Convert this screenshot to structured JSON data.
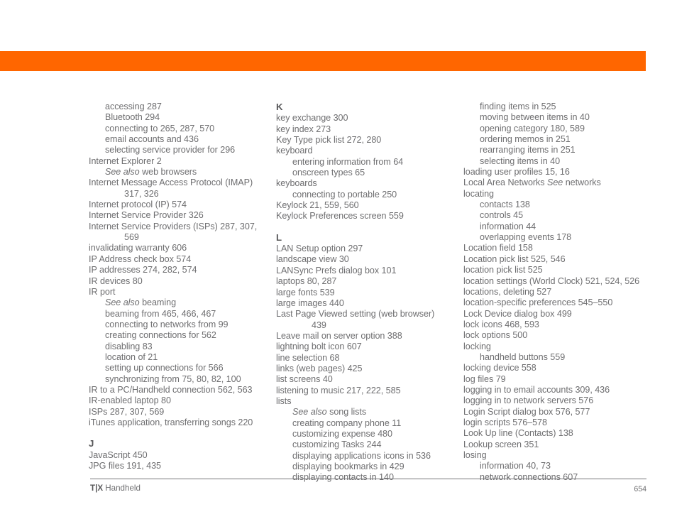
{
  "document": {
    "footer": {
      "brand": "T|X",
      "product": " Handheld",
      "page_number": "654"
    },
    "accent_color": "#ff6600",
    "text_color": "#6e6e70",
    "heading_color": "#58585a"
  },
  "columns": [
    {
      "name": "column-1",
      "blocks": [
        {
          "type": "entries",
          "items": [
            {
              "level": 1,
              "text": "accessing 287"
            },
            {
              "level": 1,
              "text": "Bluetooth 294"
            },
            {
              "level": 1,
              "text": "connecting to 265, 287, 570"
            },
            {
              "level": 1,
              "text": "email accounts and 436"
            },
            {
              "level": 1,
              "text": "selecting service provider for 296"
            },
            {
              "level": 0,
              "text": "Internet Explorer 2"
            },
            {
              "level": 1,
              "see_also": "See also",
              "text": " web browsers"
            },
            {
              "level": 0,
              "text": "Internet Message Access Protocol (IMAP)"
            },
            {
              "level": 0,
              "runover": true,
              "text": "317, 326"
            },
            {
              "level": 0,
              "text": "Internet protocol (IP) 574"
            },
            {
              "level": 0,
              "text": "Internet Service Provider 326"
            },
            {
              "level": 0,
              "text": "Internet Service Providers (ISPs) 287, 307,"
            },
            {
              "level": 0,
              "runover": true,
              "text": "569"
            },
            {
              "level": 0,
              "text": "invalidating warranty 606"
            },
            {
              "level": 0,
              "text": "IP Address check box 574"
            },
            {
              "level": 0,
              "text": "IP addresses 274, 282, 574"
            },
            {
              "level": 0,
              "text": "IR devices 80"
            },
            {
              "level": 0,
              "text": "IR port"
            },
            {
              "level": 1,
              "see_also": "See also",
              "text": " beaming"
            },
            {
              "level": 1,
              "text": "beaming from 465, 466, 467"
            },
            {
              "level": 1,
              "text": "connecting to networks from 99"
            },
            {
              "level": 1,
              "text": "creating connections for 562"
            },
            {
              "level": 1,
              "text": "disabling 83"
            },
            {
              "level": 1,
              "text": "location of 21"
            },
            {
              "level": 1,
              "text": "setting up connections for 566"
            },
            {
              "level": 1,
              "text": "synchronizing from 75, 80, 82, 100"
            },
            {
              "level": 0,
              "text": "IR to a PC/Handheld connection 562, 563"
            },
            {
              "level": 0,
              "text": "IR-enabled laptop 80"
            },
            {
              "level": 0,
              "text": "ISPs 287, 307, 569"
            },
            {
              "level": 0,
              "text": "iTunes application, transferring songs 220"
            }
          ]
        },
        {
          "type": "section",
          "letter": "J",
          "items": [
            {
              "level": 0,
              "text": "JavaScript 450"
            },
            {
              "level": 0,
              "text": "JPG files 191, 435"
            }
          ]
        }
      ]
    },
    {
      "name": "column-2",
      "blocks": [
        {
          "type": "section",
          "letter": "K",
          "first": true,
          "items": [
            {
              "level": 0,
              "text": "key exchange 300"
            },
            {
              "level": 0,
              "text": "key index 273"
            },
            {
              "level": 0,
              "text": "Key Type pick list 272, 280"
            },
            {
              "level": 0,
              "text": "keyboard"
            },
            {
              "level": 1,
              "text": "entering information from 64"
            },
            {
              "level": 1,
              "text": "onscreen types 65"
            },
            {
              "level": 0,
              "text": "keyboards"
            },
            {
              "level": 1,
              "text": "connecting to portable 250"
            },
            {
              "level": 0,
              "text": "Keylock 21, 559, 560"
            },
            {
              "level": 0,
              "text": "Keylock Preferences screen 559"
            }
          ]
        },
        {
          "type": "section",
          "letter": "L",
          "items": [
            {
              "level": 0,
              "text": "LAN Setup option 297"
            },
            {
              "level": 0,
              "text": "landscape view 30"
            },
            {
              "level": 0,
              "text": "LANSync Prefs dialog box 101"
            },
            {
              "level": 0,
              "text": "laptops 80, 287"
            },
            {
              "level": 0,
              "text": "large fonts 539"
            },
            {
              "level": 0,
              "text": "large images 440"
            },
            {
              "level": 0,
              "text": "Last Page Viewed setting (web browser)"
            },
            {
              "level": 0,
              "runover": true,
              "text": "439"
            },
            {
              "level": 0,
              "text": "Leave mail on server option 388"
            },
            {
              "level": 0,
              "text": "lightning bolt icon 607"
            },
            {
              "level": 0,
              "text": "line selection 68"
            },
            {
              "level": 0,
              "text": "links (web pages) 425"
            },
            {
              "level": 0,
              "text": "list screens 40"
            },
            {
              "level": 0,
              "text": "listening to music 217, 222, 585"
            },
            {
              "level": 0,
              "text": "lists"
            },
            {
              "level": 1,
              "see_also": "See also",
              "text": " song lists"
            },
            {
              "level": 1,
              "text": "creating company phone 11"
            },
            {
              "level": 1,
              "text": "customizing expense 480"
            },
            {
              "level": 1,
              "text": "customizing Tasks 244"
            },
            {
              "level": 1,
              "text": "displaying applications icons in 536"
            },
            {
              "level": 1,
              "text": "displaying bookmarks in 429"
            },
            {
              "level": 1,
              "text": "displaying contacts in 140"
            }
          ]
        }
      ]
    },
    {
      "name": "column-3",
      "blocks": [
        {
          "type": "entries",
          "items": [
            {
              "level": 1,
              "text": "finding items in 525"
            },
            {
              "level": 1,
              "text": "moving between items in 40"
            },
            {
              "level": 1,
              "text": "opening category 180, 589"
            },
            {
              "level": 1,
              "text": "ordering memos in 251"
            },
            {
              "level": 1,
              "text": "rearranging items in 251"
            },
            {
              "level": 1,
              "text": "selecting items in 40"
            },
            {
              "level": 0,
              "text": "loading user profiles 15, 16"
            },
            {
              "level": 0,
              "text": "Local Area Networks ",
              "see_also_mid": "See",
              "text_after": " networks"
            },
            {
              "level": 0,
              "text": "locating"
            },
            {
              "level": 1,
              "text": "contacts 138"
            },
            {
              "level": 1,
              "text": "controls 45"
            },
            {
              "level": 1,
              "text": "information 44"
            },
            {
              "level": 1,
              "text": "overlapping events 178"
            },
            {
              "level": 0,
              "text": "Location field 158"
            },
            {
              "level": 0,
              "text": "Location pick list 525, 546"
            },
            {
              "level": 0,
              "text": "location pick list 525"
            },
            {
              "level": 0,
              "text": "location settings (World Clock) 521, 524, 526"
            },
            {
              "level": 0,
              "text": "locations, deleting 527"
            },
            {
              "level": 0,
              "text": "location-specific preferences 545–550"
            },
            {
              "level": 0,
              "text": "Lock Device dialog box 499"
            },
            {
              "level": 0,
              "text": "lock icons 468, 593"
            },
            {
              "level": 0,
              "text": "lock options 500"
            },
            {
              "level": 0,
              "text": "locking"
            },
            {
              "level": 1,
              "text": "handheld buttons 559"
            },
            {
              "level": 0,
              "text": "locking device 558"
            },
            {
              "level": 0,
              "text": "log files 79"
            },
            {
              "level": 0,
              "text": "logging in to email accounts 309, 436"
            },
            {
              "level": 0,
              "text": "logging in to network servers 576"
            },
            {
              "level": 0,
              "text": "Login Script dialog box 576, 577"
            },
            {
              "level": 0,
              "text": "login scripts 576–578"
            },
            {
              "level": 0,
              "text": "Look Up line (Contacts) 138"
            },
            {
              "level": 0,
              "text": "Lookup screen 351"
            },
            {
              "level": 0,
              "text": "losing"
            },
            {
              "level": 1,
              "text": "information 40, 73"
            },
            {
              "level": 1,
              "text": "network connections 607"
            }
          ]
        }
      ]
    }
  ]
}
